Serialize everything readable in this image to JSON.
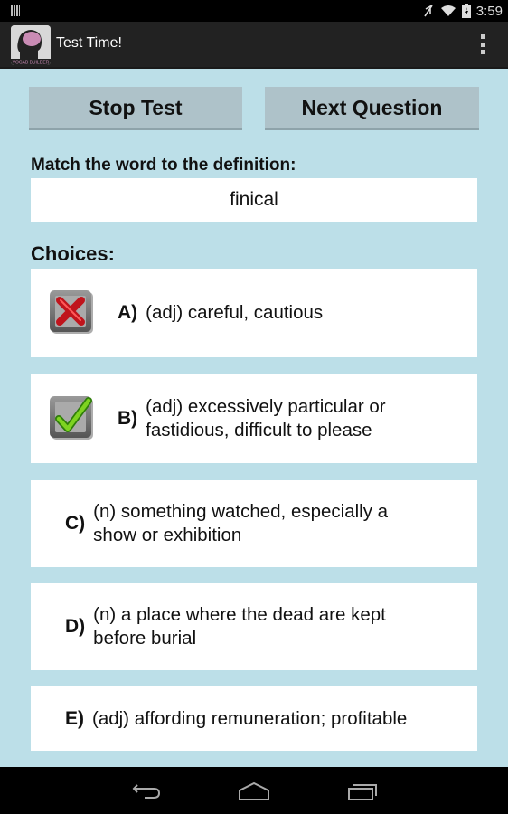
{
  "status_bar": {
    "time": "3:59",
    "icons": [
      "notification-icon",
      "mute-icon",
      "wifi-icon",
      "battery-charging-icon"
    ]
  },
  "action_bar": {
    "title": "Test Time!",
    "app_icon_label": "VOCAB BUILDER",
    "overflow_icon": "overflow-menu-icon"
  },
  "toolbar": {
    "stop_label": "Stop Test",
    "next_label": "Next Question"
  },
  "question": {
    "prompt": "Match the word to the definition:",
    "word": "finical"
  },
  "choices_label": "Choices:",
  "choices": [
    {
      "letter": "A)",
      "definition": "(adj) careful, cautious",
      "mark": "incorrect"
    },
    {
      "letter": "B)",
      "definition": "(adj) excessively particular or fastidious, difficult to please",
      "mark": "correct"
    },
    {
      "letter": "C)",
      "definition": "(n) something watched, especially a show or exhibition",
      "mark": null
    },
    {
      "letter": "D)",
      "definition": "(n) a place where the dead are kept before burial",
      "mark": null
    },
    {
      "letter": "E)",
      "definition": "(adj) affording remuneration; profitable",
      "mark": null
    }
  ],
  "nav_bar": {
    "icons": [
      "back-icon",
      "home-icon",
      "recents-icon"
    ]
  },
  "colors": {
    "background": "#bcdfe8",
    "button": "#aec2c9",
    "action_bar": "#222222"
  }
}
